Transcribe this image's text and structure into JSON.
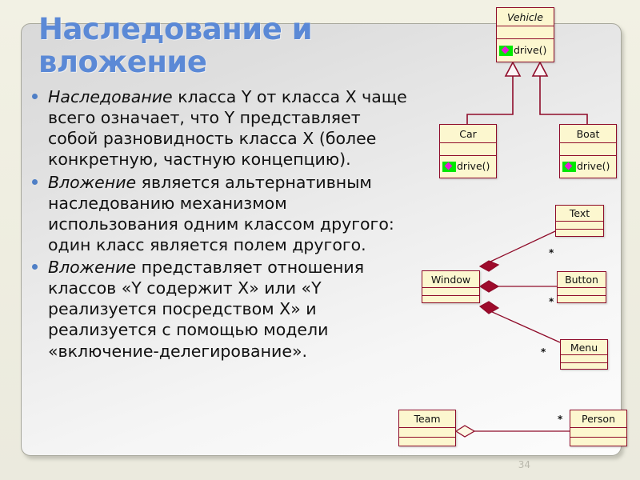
{
  "slide": {
    "title": "Наследование и вложение",
    "page_number": "34",
    "accent_color": "#5b89d6",
    "bullet_color": "#4f7fc6",
    "uml_border_color": "#8f0c2a",
    "uml_fill_color": "#fcf7cf",
    "panel_bg_color": "#ececec",
    "background_color": "#efeee0"
  },
  "bullets": [
    {
      "lead": "Наследование",
      "text": " класса Y от класса X чаще всего означает, что Y представляет собой разновидность класса X (более конкретную, частную концепцию)."
    },
    {
      "lead": "Вложение",
      "text": " является альтернативным наследованию механизмом использования одним классом другого: один класс является полем другого."
    },
    {
      "lead": "Вложение",
      "text": " представляет отношения классов «Y содержит X» или «Y реализуется посредством X» и реализуется с помощью модели «включение-делегирование»."
    }
  ],
  "diagram": {
    "inheritance": {
      "parent": {
        "name": "Vehicle",
        "abstract": true,
        "operation": "drive()",
        "icon": "public-method-icon"
      },
      "children": [
        {
          "name": "Car",
          "abstract": false,
          "operation": "drive()",
          "icon": "public-method-icon"
        },
        {
          "name": "Boat",
          "abstract": false,
          "operation": "drive()",
          "icon": "public-method-icon"
        }
      ]
    },
    "composition": {
      "whole": {
        "name": "Window"
      },
      "parts": [
        {
          "name": "Text",
          "multiplicity": "*"
        },
        {
          "name": "Button",
          "multiplicity": "*"
        },
        {
          "name": "Menu",
          "multiplicity": "*"
        }
      ]
    },
    "aggregation": {
      "whole": {
        "name": "Team"
      },
      "part": {
        "name": "Person",
        "multiplicity": "*"
      }
    }
  }
}
